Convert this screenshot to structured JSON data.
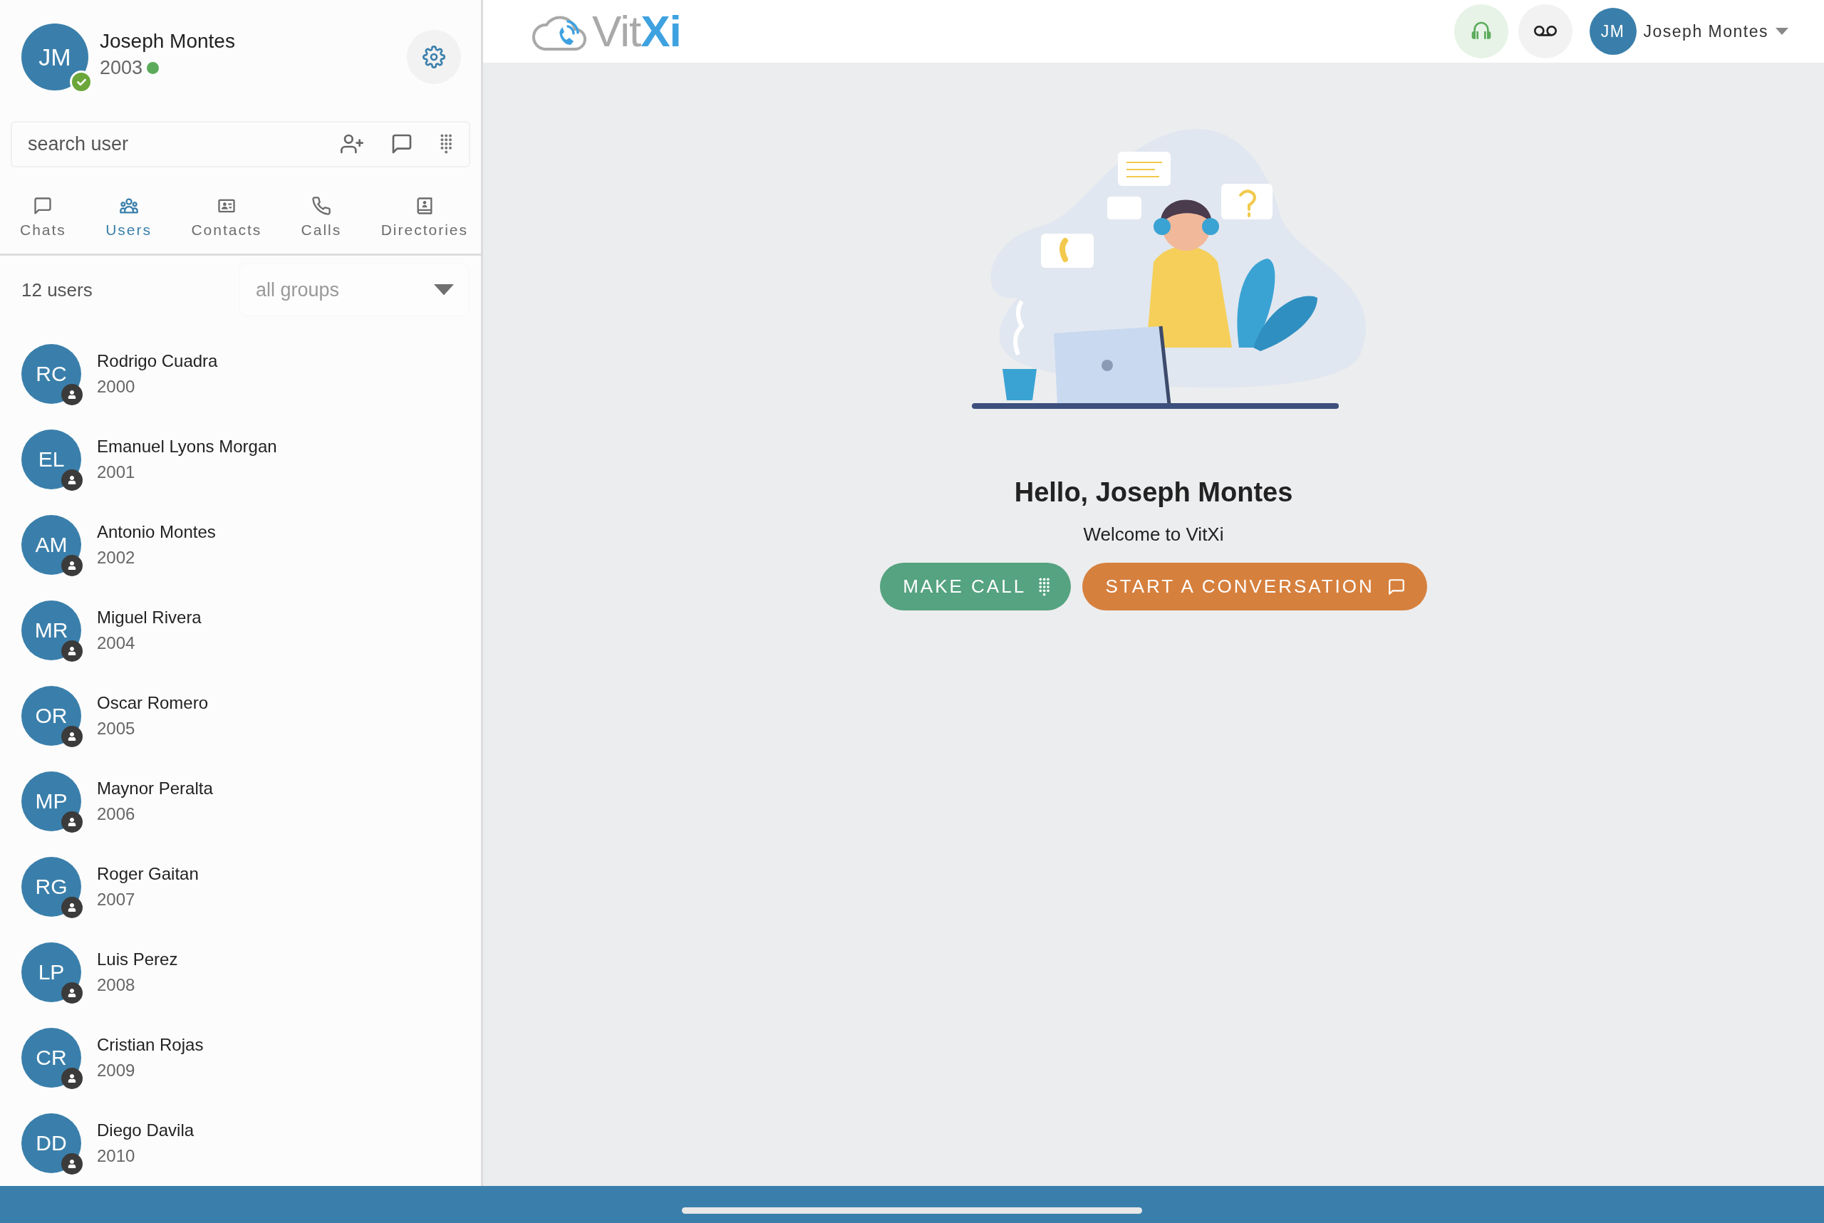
{
  "profile": {
    "initials": "JM",
    "name": "Joseph Montes",
    "extension": "2003",
    "online": true,
    "verified": true
  },
  "search": {
    "placeholder": "search user"
  },
  "tabs": [
    {
      "label": "Chats",
      "selected": false
    },
    {
      "label": "Users",
      "selected": true
    },
    {
      "label": "Contacts",
      "selected": false
    },
    {
      "label": "Calls",
      "selected": false
    },
    {
      "label": "Directories",
      "selected": false
    }
  ],
  "user_count": "12 users",
  "group_filter": {
    "placeholder": "all groups"
  },
  "users": [
    {
      "initials": "RC",
      "name": "Rodrigo Cuadra",
      "extension": "2000"
    },
    {
      "initials": "EL",
      "name": "Emanuel Lyons Morgan",
      "extension": "2001"
    },
    {
      "initials": "AM",
      "name": "Antonio Montes",
      "extension": "2002"
    },
    {
      "initials": "MR",
      "name": "Miguel Rivera",
      "extension": "2004"
    },
    {
      "initials": "OR",
      "name": "Oscar Romero",
      "extension": "2005"
    },
    {
      "initials": "MP",
      "name": "Maynor Peralta",
      "extension": "2006"
    },
    {
      "initials": "RG",
      "name": "Roger Gaitan",
      "extension": "2007"
    },
    {
      "initials": "LP",
      "name": "Luis Perez",
      "extension": "2008"
    },
    {
      "initials": "CR",
      "name": "Cristian Rojas",
      "extension": "2009"
    },
    {
      "initials": "DD",
      "name": "Diego Davila",
      "extension": "2010"
    }
  ],
  "logo": {
    "text_1": "Vit",
    "text_2": "Xi"
  },
  "top_user": {
    "initials": "JM",
    "name": "Joseph Montes"
  },
  "welcome": {
    "title": "Hello, Joseph Montes",
    "subtitle": "Welcome to VitXi"
  },
  "actions": [
    {
      "label": "MAKE CALL",
      "kind": "call"
    },
    {
      "label": "START A CONVERSATION",
      "kind": "chat"
    }
  ]
}
